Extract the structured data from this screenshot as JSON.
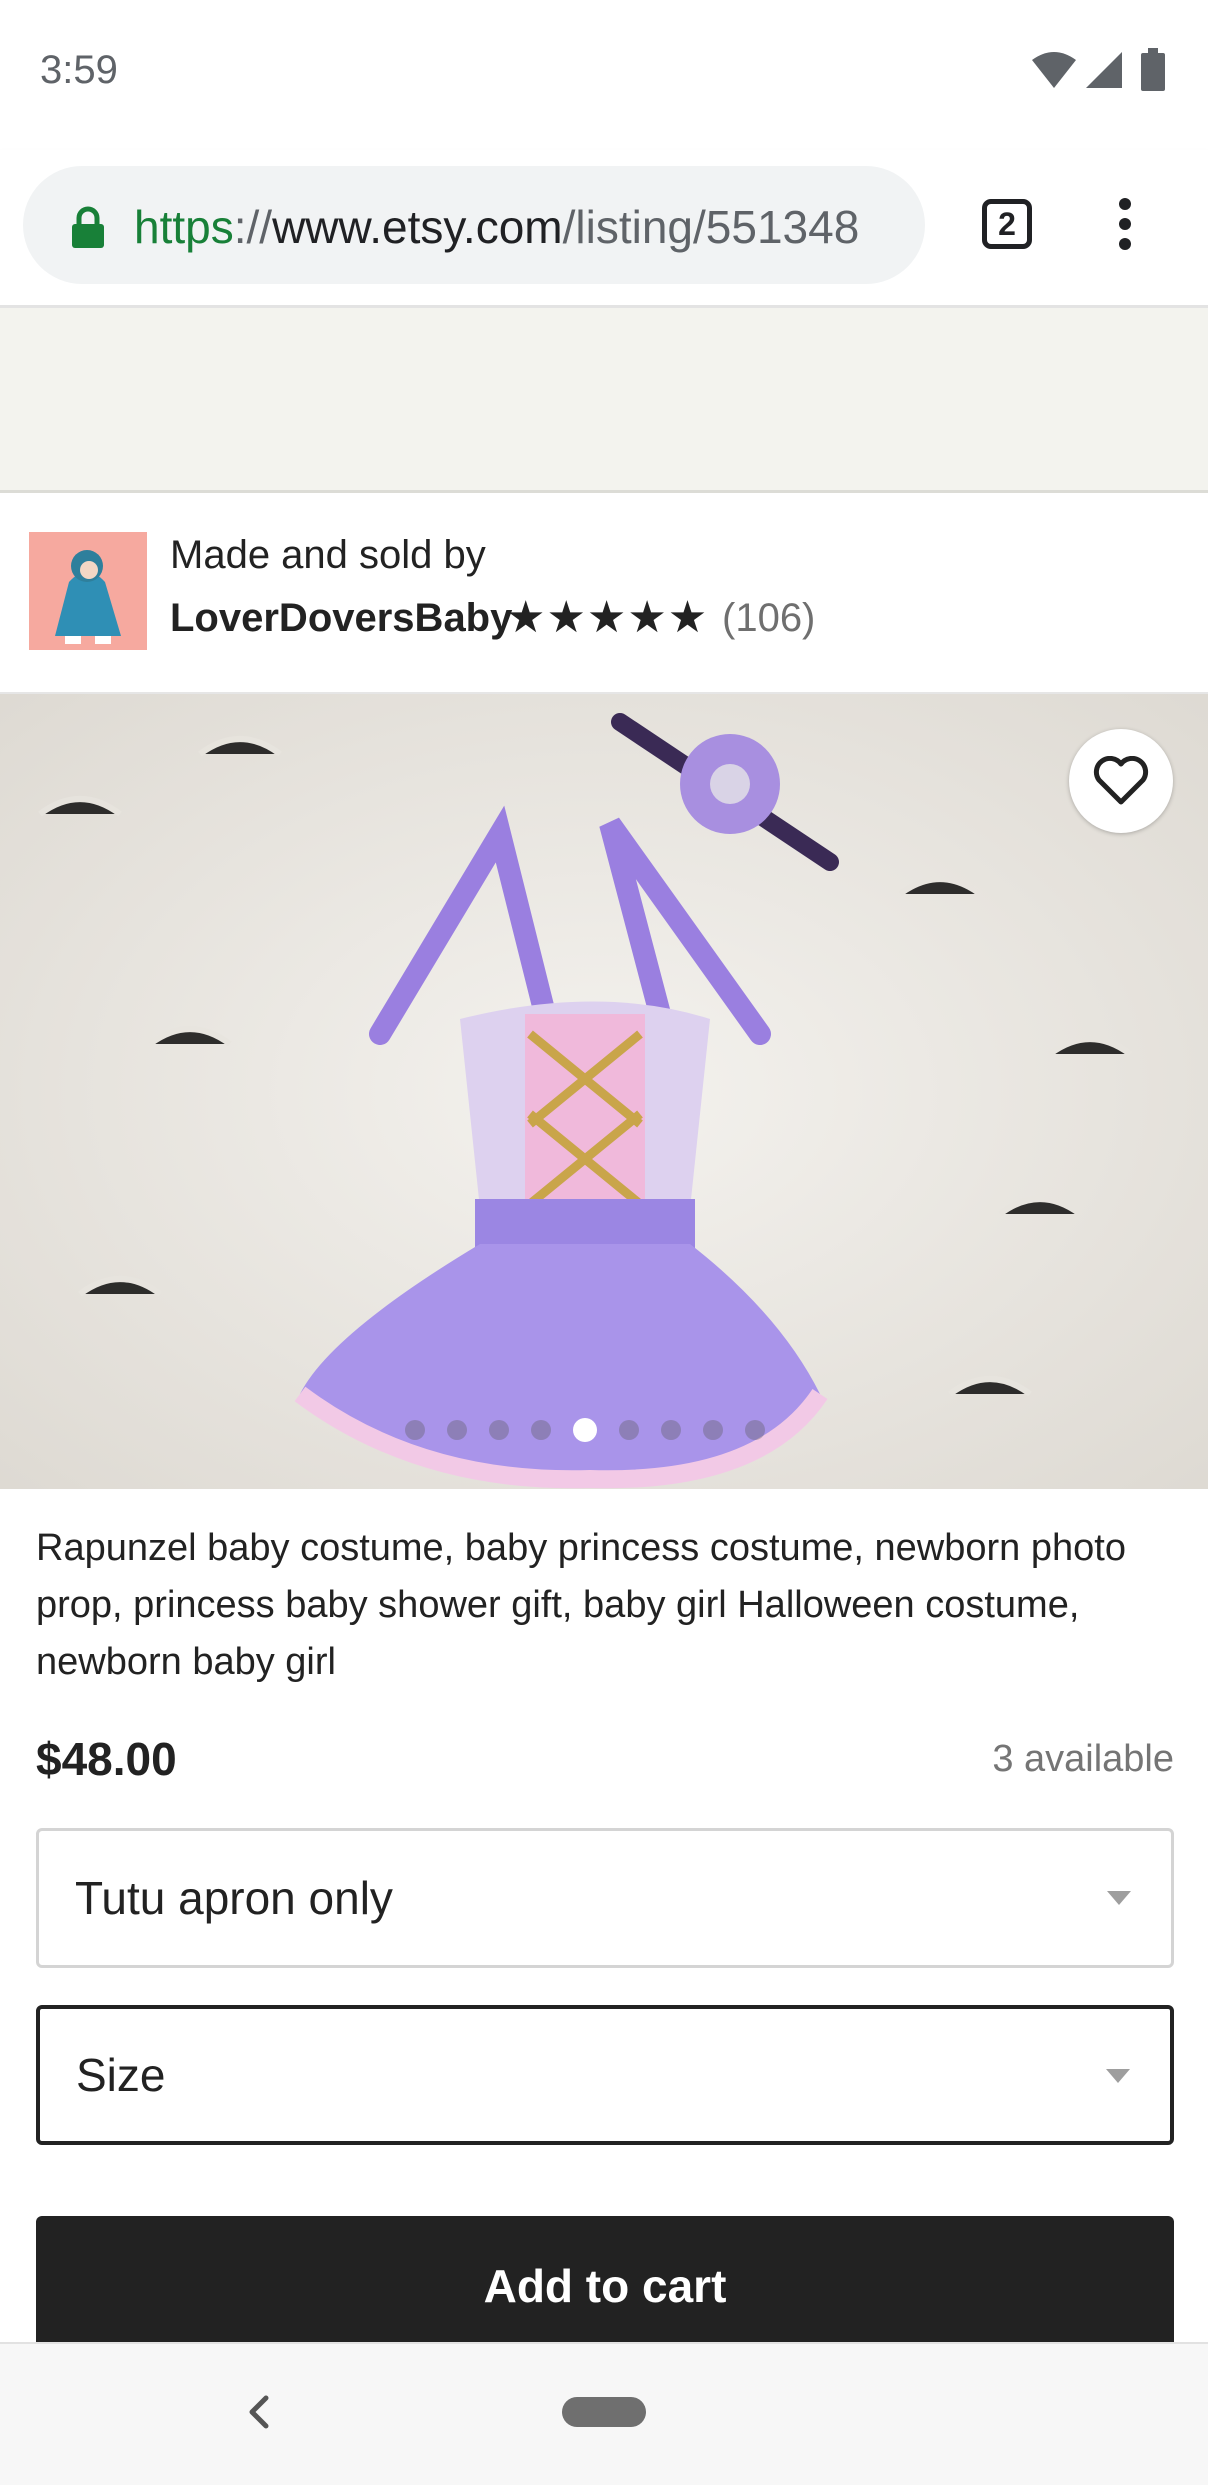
{
  "status_bar": {
    "time": "3:59"
  },
  "browser": {
    "url": {
      "scheme": "https",
      "separator": "://",
      "host": "www.etsy.com",
      "path": "/listing/551348"
    },
    "tab_count": "2"
  },
  "shop": {
    "made_by_label": "Made and sold by",
    "name": "LoverDoversBaby",
    "stars": "★★★★★",
    "rating": 5,
    "review_count": "(106)"
  },
  "listing": {
    "title": "Rapunzel baby costume, baby princess costume, newborn photo prop, princess baby shower gift, baby girl Halloween costume, newborn baby girl",
    "price": "$48.00",
    "availability": "3 available",
    "carousel": {
      "total": 9,
      "active_index": 4
    }
  },
  "options": {
    "variation_value": "Tutu apron only",
    "size_value": "Size"
  },
  "actions": {
    "add_to_cart_label": "Add to cart"
  },
  "colors": {
    "accent_dark": "#222222",
    "secure_green": "#188038",
    "banner_bg": "#f3f3ee"
  },
  "icons": [
    "wifi-icon",
    "signal-icon",
    "battery-icon",
    "lock-icon",
    "menu-icon",
    "heart-icon",
    "back-icon"
  ]
}
